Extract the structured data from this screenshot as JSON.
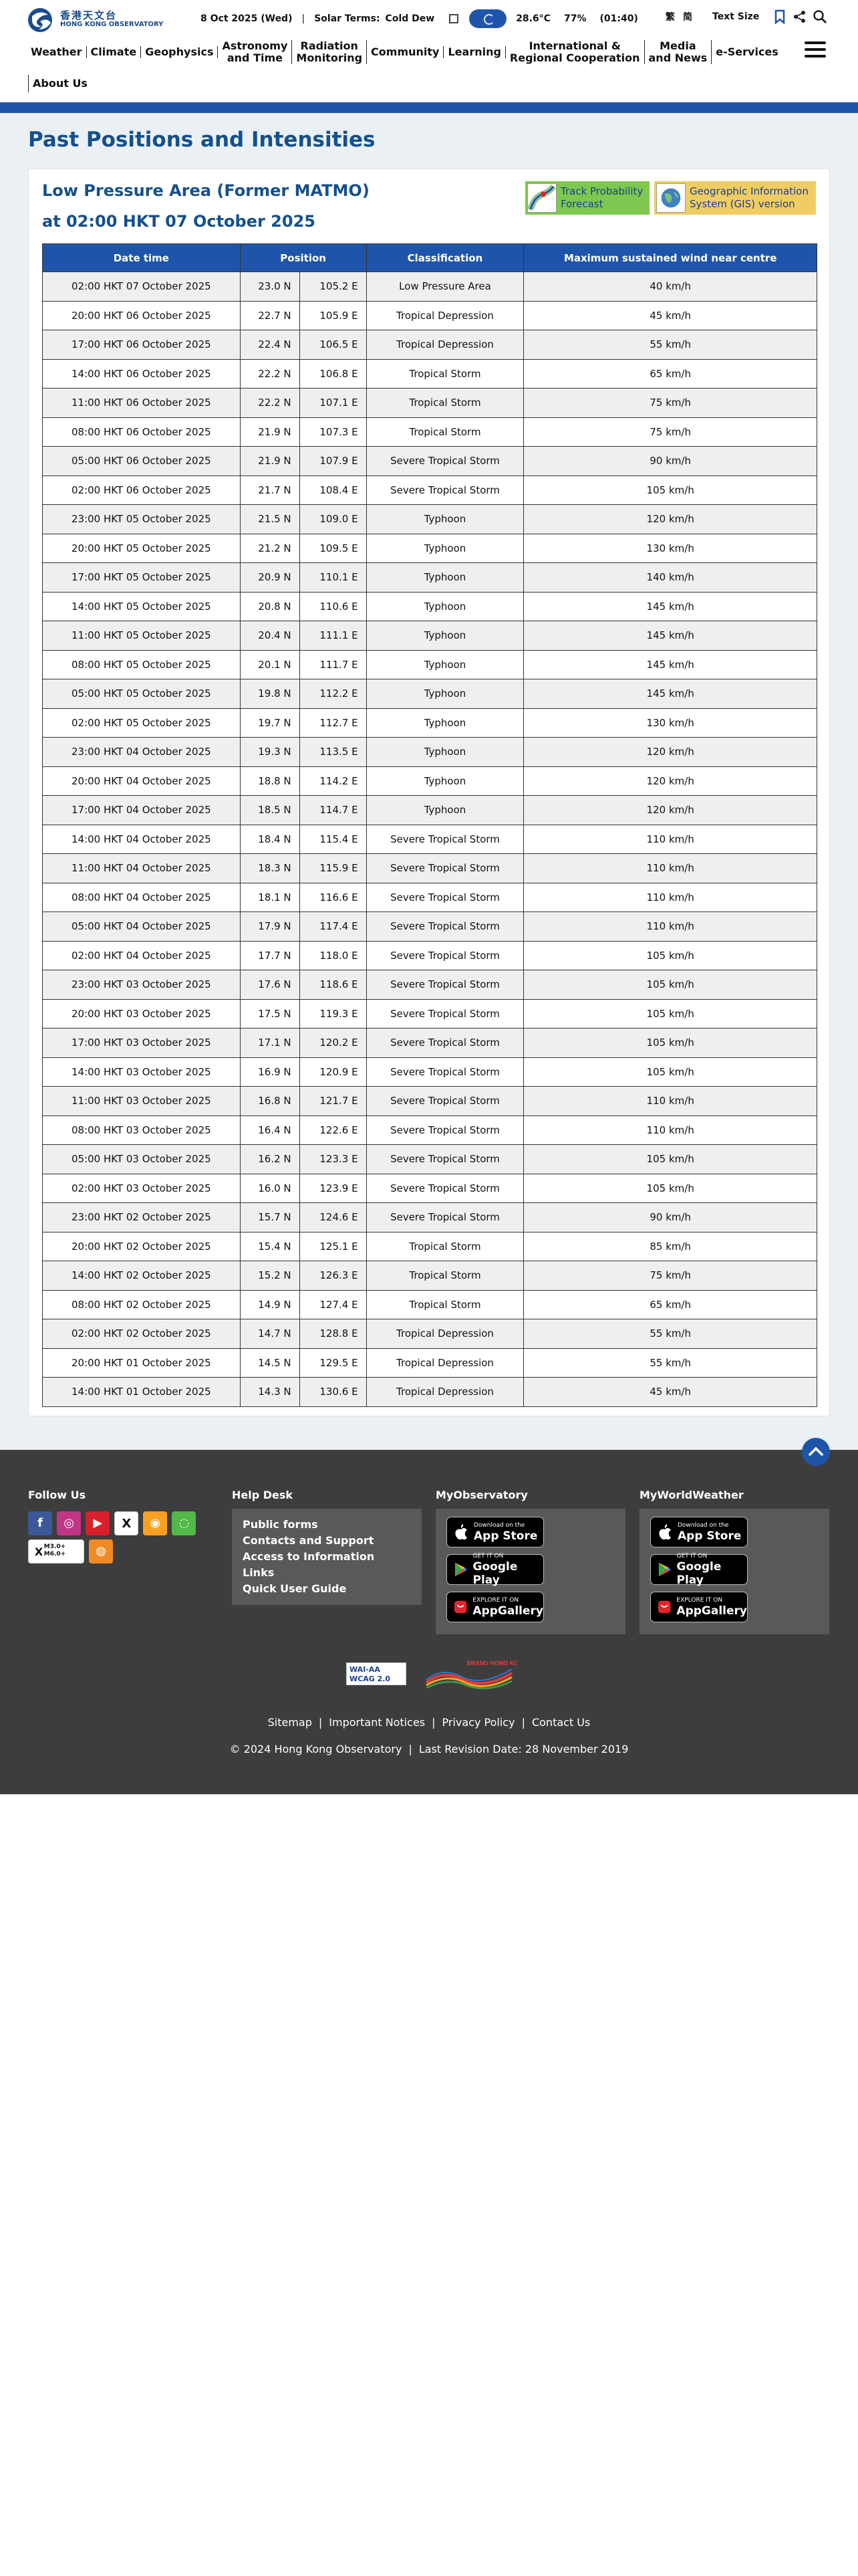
{
  "header": {
    "logo_cn": "香港天文台",
    "logo_en": "HONG KONG OBSERVATORY",
    "date": "8 Oct 2025 (Wed)",
    "solar_terms_label": "Solar Terms:",
    "solar_term": "Cold Dew",
    "temperature": "28.6°C",
    "humidity": "77%",
    "time": "(01:40)",
    "lang_tc": "繁",
    "lang_sc": "简",
    "text_size": "Text Size"
  },
  "nav": {
    "items": [
      "Weather",
      "Climate",
      "Geophysics",
      "Astronomy\nand Time",
      "Radiation\nMonitoring",
      "Community",
      "Learning",
      "International &\nRegional Cooperation",
      "Media\nand News",
      "e-Services"
    ],
    "about": "About Us"
  },
  "page": {
    "title": "Past Positions and Intensities",
    "storm_title": "Low Pressure Area (Former MATMO)",
    "storm_time": "at 02:00 HKT 07 October 2025",
    "track_btn": "Track Probability Forecast",
    "gis_btn": "Geographic Information System (GIS) version"
  },
  "table": {
    "headers": [
      "Date time",
      "Position",
      "Classification",
      "Maximum sustained wind near centre"
    ],
    "rows": [
      [
        "02:00 HKT 07 October 2025",
        "23.0 N",
        "105.2 E",
        "Low Pressure Area",
        "40 km/h"
      ],
      [
        "20:00 HKT 06 October 2025",
        "22.7 N",
        "105.9 E",
        "Tropical Depression",
        "45 km/h"
      ],
      [
        "17:00 HKT 06 October 2025",
        "22.4 N",
        "106.5 E",
        "Tropical Depression",
        "55 km/h"
      ],
      [
        "14:00 HKT 06 October 2025",
        "22.2 N",
        "106.8 E",
        "Tropical Storm",
        "65 km/h"
      ],
      [
        "11:00 HKT 06 October 2025",
        "22.2 N",
        "107.1 E",
        "Tropical Storm",
        "75 km/h"
      ],
      [
        "08:00 HKT 06 October 2025",
        "21.9 N",
        "107.3 E",
        "Tropical Storm",
        "75 km/h"
      ],
      [
        "05:00 HKT 06 October 2025",
        "21.9 N",
        "107.9 E",
        "Severe Tropical Storm",
        "90 km/h"
      ],
      [
        "02:00 HKT 06 October 2025",
        "21.7 N",
        "108.4 E",
        "Severe Tropical Storm",
        "105 km/h"
      ],
      [
        "23:00 HKT 05 October 2025",
        "21.5 N",
        "109.0 E",
        "Typhoon",
        "120 km/h"
      ],
      [
        "20:00 HKT 05 October 2025",
        "21.2 N",
        "109.5 E",
        "Typhoon",
        "130 km/h"
      ],
      [
        "17:00 HKT 05 October 2025",
        "20.9 N",
        "110.1 E",
        "Typhoon",
        "140 km/h"
      ],
      [
        "14:00 HKT 05 October 2025",
        "20.8 N",
        "110.6 E",
        "Typhoon",
        "145 km/h"
      ],
      [
        "11:00 HKT 05 October 2025",
        "20.4 N",
        "111.1 E",
        "Typhoon",
        "145 km/h"
      ],
      [
        "08:00 HKT 05 October 2025",
        "20.1 N",
        "111.7 E",
        "Typhoon",
        "145 km/h"
      ],
      [
        "05:00 HKT 05 October 2025",
        "19.8 N",
        "112.2 E",
        "Typhoon",
        "145 km/h"
      ],
      [
        "02:00 HKT 05 October 2025",
        "19.7 N",
        "112.7 E",
        "Typhoon",
        "130 km/h"
      ],
      [
        "23:00 HKT 04 October 2025",
        "19.3 N",
        "113.5 E",
        "Typhoon",
        "120 km/h"
      ],
      [
        "20:00 HKT 04 October 2025",
        "18.8 N",
        "114.2 E",
        "Typhoon",
        "120 km/h"
      ],
      [
        "17:00 HKT 04 October 2025",
        "18.5 N",
        "114.7 E",
        "Typhoon",
        "120 km/h"
      ],
      [
        "14:00 HKT 04 October 2025",
        "18.4 N",
        "115.4 E",
        "Severe Tropical Storm",
        "110 km/h"
      ],
      [
        "11:00 HKT 04 October 2025",
        "18.3 N",
        "115.9 E",
        "Severe Tropical Storm",
        "110 km/h"
      ],
      [
        "08:00 HKT 04 October 2025",
        "18.1 N",
        "116.6 E",
        "Severe Tropical Storm",
        "110 km/h"
      ],
      [
        "05:00 HKT 04 October 2025",
        "17.9 N",
        "117.4 E",
        "Severe Tropical Storm",
        "110 km/h"
      ],
      [
        "02:00 HKT 04 October 2025",
        "17.7 N",
        "118.0 E",
        "Severe Tropical Storm",
        "105 km/h"
      ],
      [
        "23:00 HKT 03 October 2025",
        "17.6 N",
        "118.6 E",
        "Severe Tropical Storm",
        "105 km/h"
      ],
      [
        "20:00 HKT 03 October 2025",
        "17.5 N",
        "119.3 E",
        "Severe Tropical Storm",
        "105 km/h"
      ],
      [
        "17:00 HKT 03 October 2025",
        "17.1 N",
        "120.2 E",
        "Severe Tropical Storm",
        "105 km/h"
      ],
      [
        "14:00 HKT 03 October 2025",
        "16.9 N",
        "120.9 E",
        "Severe Tropical Storm",
        "105 km/h"
      ],
      [
        "11:00 HKT 03 October 2025",
        "16.8 N",
        "121.7 E",
        "Severe Tropical Storm",
        "110 km/h"
      ],
      [
        "08:00 HKT 03 October 2025",
        "16.4 N",
        "122.6 E",
        "Severe Tropical Storm",
        "110 km/h"
      ],
      [
        "05:00 HKT 03 October 2025",
        "16.2 N",
        "123.3 E",
        "Severe Tropical Storm",
        "105 km/h"
      ],
      [
        "02:00 HKT 03 October 2025",
        "16.0 N",
        "123.9 E",
        "Severe Tropical Storm",
        "105 km/h"
      ],
      [
        "23:00 HKT 02 October 2025",
        "15.7 N",
        "124.6 E",
        "Severe Tropical Storm",
        "90 km/h"
      ],
      [
        "20:00 HKT 02 October 2025",
        "15.4 N",
        "125.1 E",
        "Tropical Storm",
        "85 km/h"
      ],
      [
        "14:00 HKT 02 October 2025",
        "15.2 N",
        "126.3 E",
        "Tropical Storm",
        "75 km/h"
      ],
      [
        "08:00 HKT 02 October 2025",
        "14.9 N",
        "127.4 E",
        "Tropical Storm",
        "65 km/h"
      ],
      [
        "02:00 HKT 02 October 2025",
        "14.7 N",
        "128.8 E",
        "Tropical Depression",
        "55 km/h"
      ],
      [
        "20:00 HKT 01 October 2025",
        "14.5 N",
        "129.5 E",
        "Tropical Depression",
        "55 km/h"
      ],
      [
        "14:00 HKT 01 October 2025",
        "14.3 N",
        "130.6 E",
        "Tropical Depression",
        "45 km/h"
      ]
    ]
  },
  "footer": {
    "follow_us": "Follow Us",
    "help_desk": "Help Desk",
    "help_links": [
      "Public forms",
      "Contacts and Support",
      "Access to Information",
      "Links",
      "Quick User Guide"
    ],
    "my_observatory": "MyObservatory",
    "my_world_weather": "MyWorldWeather",
    "stores": {
      "apple_small": "Download on the",
      "apple_big": "App Store",
      "google_small": "GET IT ON",
      "google_big": "Google Play",
      "huawei_small": "EXPLORE IT ON",
      "huawei_big": "AppGallery"
    },
    "quake_badge_1": "M3.0+",
    "quake_badge_2": "M6.0+",
    "wcag": "WAI-AA WCAG 2.0",
    "brand_logo": "BRAND HONG KONG",
    "links": [
      "Sitemap",
      "Important Notices",
      "Privacy Policy",
      "Contact Us"
    ],
    "copyright": "© 2024 Hong Kong Observatory",
    "revision": "Last Revision Date: 28 November 2019"
  },
  "colors": {
    "brand_blue": "#1e55aa",
    "title_blue": "#14508c",
    "track_green": "#7ec84f",
    "gis_yellow": "#f0cd63",
    "footer_dark": "#3d3d3d"
  },
  "icons": {
    "bookmark": "bookmark-icon",
    "share": "share-icon",
    "search": "search-icon",
    "menu": "hamburger-menu-icon",
    "theme": "moon-icon",
    "calendar": "calendar-icon",
    "back_to_top": "chevron-up-icon"
  }
}
